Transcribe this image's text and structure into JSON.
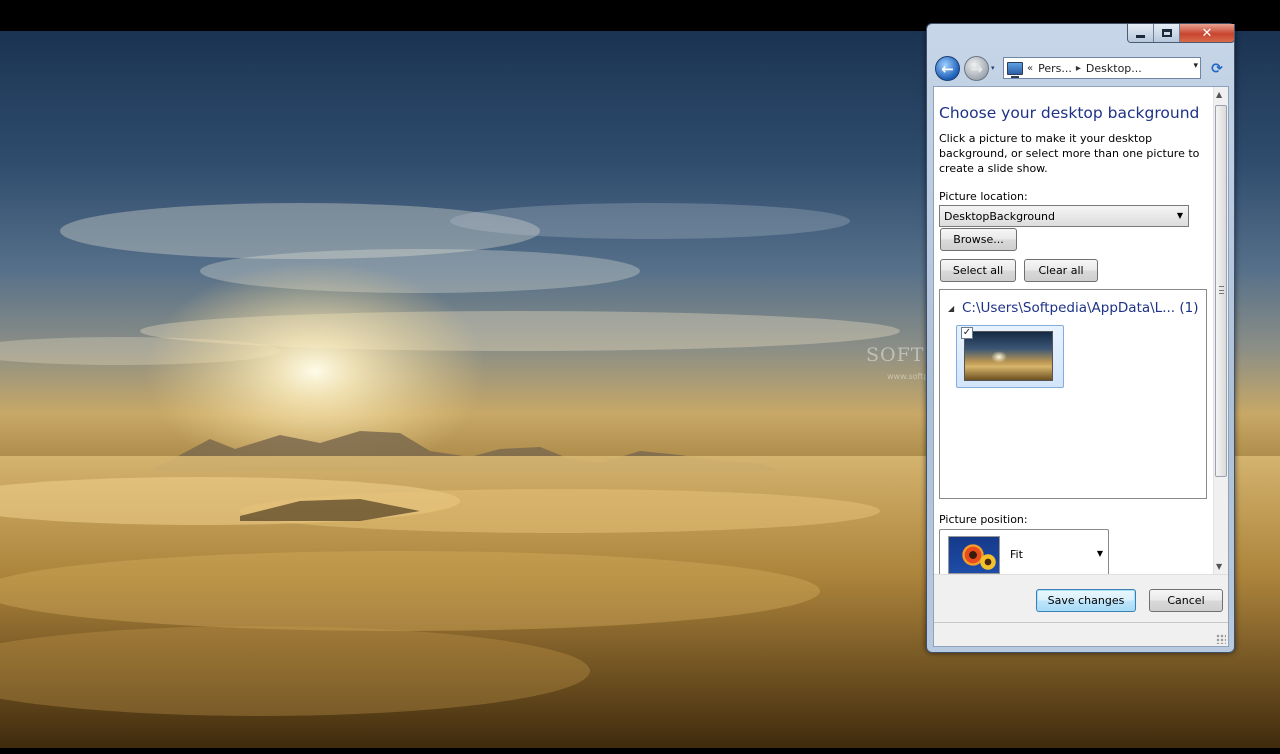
{
  "wallpaper": {
    "watermark": "SOFTPEDIA",
    "watermark_sub": "www.softpedia.com"
  },
  "window": {
    "caption_buttons": {
      "minimize_icon": "minimize-icon",
      "maximize_icon": "maximize-icon",
      "close_glyph": "✕"
    },
    "nav": {
      "back_glyph": "←",
      "forward_glyph": "→",
      "history_glyph": "▾",
      "address": {
        "prefix": "«",
        "parts": [
          "Pers...",
          "Desktop..."
        ],
        "separator": "▸",
        "dropdown_glyph": "▾"
      },
      "refresh_glyph": "⟳"
    },
    "content": {
      "title": "Choose your desktop background",
      "description": "Click a picture to make it your desktop background, or select more than one picture to create a slide show.",
      "picture_location_label": "Picture location:",
      "picture_location_value": "DesktopBackground",
      "browse_label": "Browse...",
      "select_all_label": "Select all",
      "clear_all_label": "Clear all",
      "group": {
        "collapse_glyph": "◢",
        "header": "C:\\Users\\Softpedia\\AppData\\L...  (1)",
        "thumbnails": [
          {
            "checked": true,
            "check_glyph": "✓"
          }
        ]
      },
      "picture_position_label": "Picture position:",
      "picture_position_value": "Fit",
      "dropdown_glyph": "▼"
    },
    "scrollbar": {
      "up_glyph": "▲",
      "down_glyph": "▼"
    },
    "footer": {
      "save_label": "Save changes",
      "cancel_label": "Cancel"
    }
  },
  "colors": {
    "title_blue": "#1e3287",
    "close_red": "#c8452f",
    "window_frame": "#adc1d8",
    "default_button_border": "#3c7fb1"
  }
}
